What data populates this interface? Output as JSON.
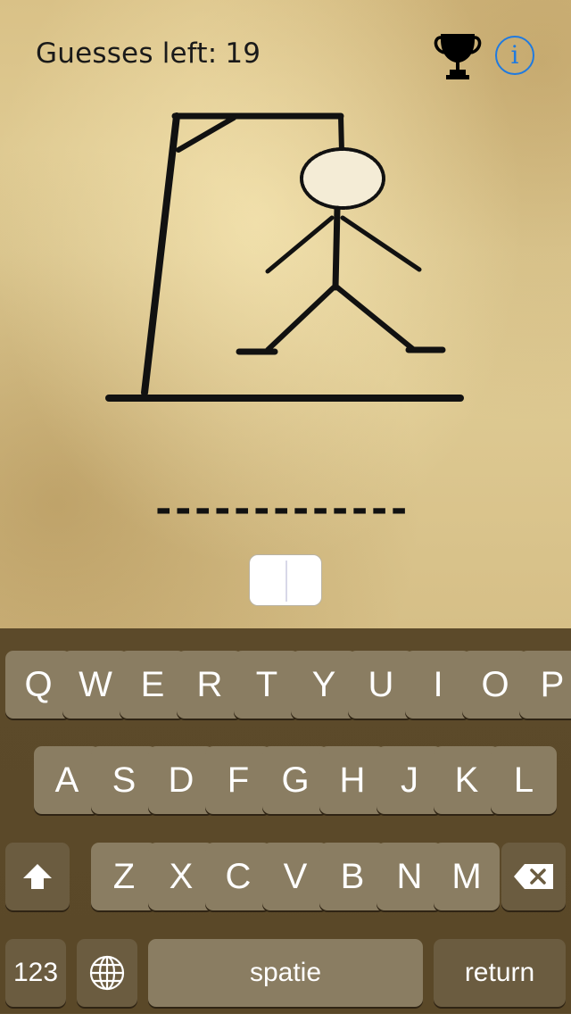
{
  "header": {
    "guesses_label": "Guesses left:",
    "guesses_left": "19",
    "trophy_icon": "trophy-icon",
    "info_glyph": "i",
    "info_color": "#1f7ae0"
  },
  "game": {
    "word_mask": "-------------",
    "letter_count": 13,
    "input_value": ""
  },
  "keyboard": {
    "row1": [
      "Q",
      "W",
      "E",
      "R",
      "T",
      "Y",
      "U",
      "I",
      "O",
      "P"
    ],
    "row2": [
      "A",
      "S",
      "D",
      "F",
      "G",
      "H",
      "J",
      "K",
      "L"
    ],
    "row3": [
      "Z",
      "X",
      "C",
      "V",
      "B",
      "N",
      "M"
    ],
    "numbers_label": "123",
    "space_label": "spatie",
    "return_label": "return",
    "shift_icon": "shift-icon",
    "globe_icon": "globe-icon",
    "backspace_icon": "backspace-icon"
  }
}
